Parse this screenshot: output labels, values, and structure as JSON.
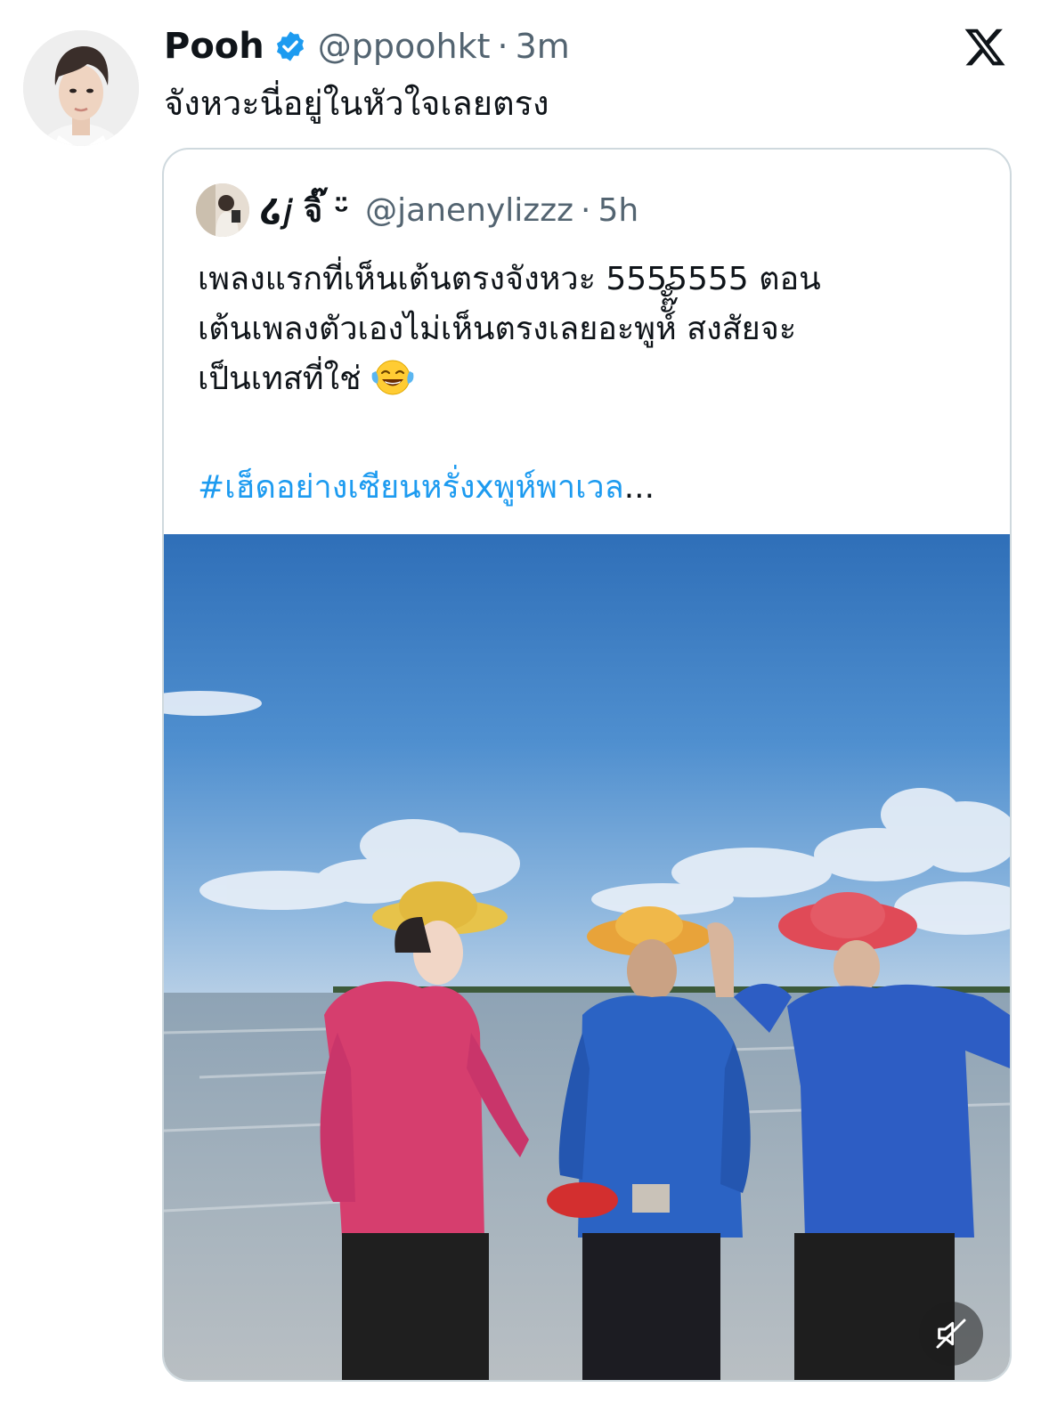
{
  "tweet": {
    "author_name": "Pooh",
    "handle": "@ppoohkt",
    "separator": "·",
    "time": "3m",
    "text": "จังหวะนี่อยู่ในหัวใจเลยตรง",
    "verified": true,
    "brand_color": "#1d9bf0"
  },
  "quote": {
    "author_name": "໒𝑗 จิ๊ ᵕ̈",
    "handle": "@janenylizzz",
    "separator": "·",
    "time": "5h",
    "text_lines": [
      "เพลงแรกที่เห็นเต้นตรงจังหวะ 5555555 ตอน",
      "เต้นเพลงตัวเองไม่เห็นตรงเลยอะพูห์ั๊ั์ สงสัยจะ",
      "เป็นเทสที่ใช่"
    ],
    "emoji": "face-with-tears-of-joy",
    "hashtag": "#เฮ็ดอย่างเซียนหรั่งxพูห์พาเวล",
    "ellipsis": "...",
    "media": {
      "type": "video",
      "muted": true,
      "icon": "speaker-muted-icon"
    }
  },
  "icons": {
    "logo": "x-logo-icon",
    "verified": "verified-badge-icon"
  }
}
